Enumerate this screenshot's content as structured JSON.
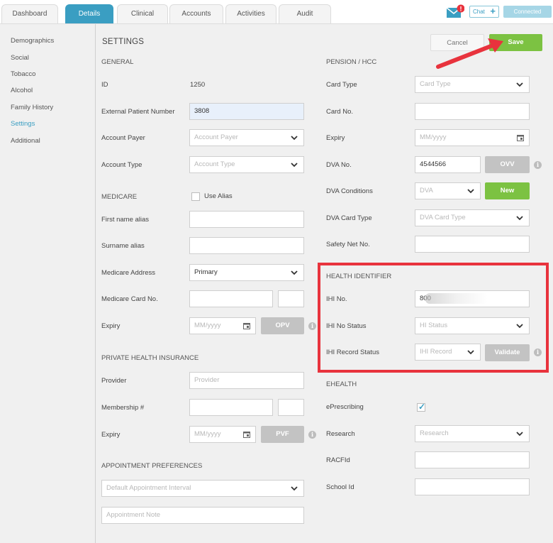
{
  "tabs": [
    {
      "label": "Dashboard"
    },
    {
      "label": "Details"
    },
    {
      "label": "Clinical"
    },
    {
      "label": "Accounts"
    },
    {
      "label": "Activities"
    },
    {
      "label": "Audit"
    }
  ],
  "topright": {
    "chat_label": "Chat",
    "connected_label": "Connected",
    "notification_badge": "!"
  },
  "sidenav": [
    "Demographics",
    "Social",
    "Tobacco",
    "Alcohol",
    "Family History",
    "Settings",
    "Additional"
  ],
  "page": {
    "title": "SETTINGS",
    "cancel_label": "Cancel",
    "save_label": "Save"
  },
  "general": {
    "heading": "GENERAL",
    "id_label": "ID",
    "id_value": "1250",
    "ext_label": "External Patient Number",
    "ext_value": "3808",
    "payer_label": "Account Payer",
    "payer_placeholder": "Account Payer",
    "type_label": "Account Type",
    "type_placeholder": "Account Type"
  },
  "medicare": {
    "heading": "MEDICARE",
    "use_alias_label": "Use Alias",
    "first_alias_label": "First name alias",
    "surname_alias_label": "Surname alias",
    "address_label": "Medicare Address",
    "address_value": "Primary",
    "card_label": "Medicare Card No.",
    "expiry_label": "Expiry",
    "expiry_placeholder": "MM/yyyy",
    "opv_label": "OPV"
  },
  "private_health": {
    "heading": "PRIVATE HEALTH INSURANCE",
    "provider_label": "Provider",
    "provider_placeholder": "Provider",
    "membership_label": "Membership #",
    "expiry_label": "Expiry",
    "expiry_placeholder": "MM/yyyy",
    "pvf_label": "PVF"
  },
  "appointment": {
    "heading": "APPOINTMENT PREFERENCES",
    "interval_placeholder": "Default Appointment Interval",
    "note_placeholder": "Appointment Note"
  },
  "pension": {
    "heading": "PENSION / HCC",
    "card_type_label": "Card Type",
    "card_type_placeholder": "Card Type",
    "card_no_label": "Card No.",
    "expiry_label": "Expiry",
    "expiry_placeholder": "MM/yyyy",
    "dva_no_label": "DVA No.",
    "dva_no_value": "4544566",
    "ovv_label": "OVV",
    "dva_conditions_label": "DVA Conditions",
    "dva_conditions_placeholder": "DVA",
    "new_label": "New",
    "dva_card_type_label": "DVA Card Type",
    "dva_card_type_placeholder": "DVA Card Type",
    "safety_net_label": "Safety Net No."
  },
  "health_identifier": {
    "heading": "HEALTH IDENTIFIER",
    "ihi_no_label": "IHI No.",
    "ihi_no_value": "800",
    "ihi_status_label": "IHI No Status",
    "ihi_status_placeholder": "HI Status",
    "ihi_record_label": "IHI Record Status",
    "ihi_record_placeholder": "IHI Record",
    "validate_label": "Validate"
  },
  "ehealth": {
    "heading": "EHEALTH",
    "eprescribing_label": "ePrescribing",
    "research_label": "Research",
    "research_placeholder": "Research",
    "racfid_label": "RACFId",
    "school_id_label": "School Id"
  },
  "colors": {
    "accent": "#3a9ec2",
    "save": "#7cc242",
    "highlight": "#e8333d"
  }
}
